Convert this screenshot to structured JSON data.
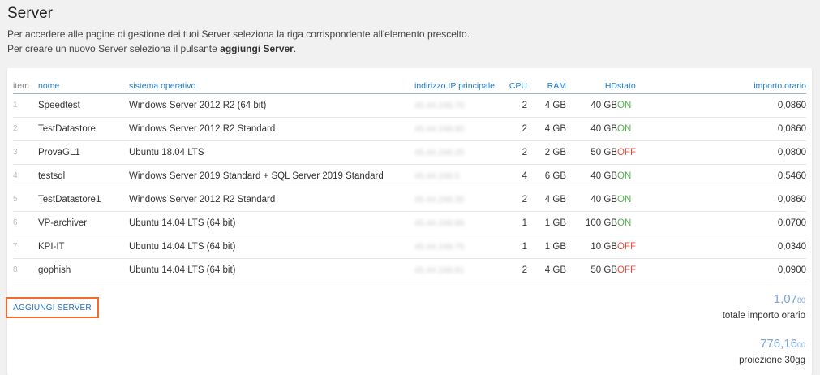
{
  "page": {
    "title": "Server",
    "desc1": "Per accedere alle pagine di gestione dei tuoi Server seleziona la riga corrispondente all'elemento prescelto.",
    "desc2_prefix": "Per creare un nuovo Server seleziona il pulsante ",
    "desc2_bold": "aggiungi Server",
    "desc2_suffix": "."
  },
  "table": {
    "headers": [
      "item",
      "nome",
      "sistema operativo",
      "indirizzo IP principale",
      "CPU",
      "RAM",
      "HD",
      "stato",
      "importo orario"
    ],
    "rows": [
      {
        "item": "1",
        "nome": "Speedtest",
        "os": "Windows Server 2012 R2 (64 bit)",
        "ip": "45.44.248.70",
        "cpu": "2",
        "ram": "4 GB",
        "hd": "40 GB",
        "stato": "ON",
        "importo": "0,0860"
      },
      {
        "item": "2",
        "nome": "TestDatastore",
        "os": "Windows Server 2012 R2 Standard",
        "ip": "45.44.248.80",
        "cpu": "2",
        "ram": "4 GB",
        "hd": "40 GB",
        "stato": "ON",
        "importo": "0,0860"
      },
      {
        "item": "3",
        "nome": "ProvaGL1",
        "os": "Ubuntu 18.04 LTS",
        "ip": "45.44.248.25",
        "cpu": "2",
        "ram": "2 GB",
        "hd": "50 GB",
        "stato": "OFF",
        "importo": "0,0800"
      },
      {
        "item": "4",
        "nome": "testsql",
        "os": "Windows Server 2019 Standard + SQL Server 2019 Standard",
        "ip": "45.44.248.5",
        "cpu": "4",
        "ram": "6 GB",
        "hd": "40 GB",
        "stato": "ON",
        "importo": "0,5460"
      },
      {
        "item": "5",
        "nome": "TestDatastore1",
        "os": "Windows Server 2012 R2 Standard",
        "ip": "45.44.248.35",
        "cpu": "2",
        "ram": "4 GB",
        "hd": "40 GB",
        "stato": "ON",
        "importo": "0,0860"
      },
      {
        "item": "6",
        "nome": "VP-archiver",
        "os": "Ubuntu 14.04 LTS (64 bit)",
        "ip": "45.44.248.88",
        "cpu": "1",
        "ram": "1 GB",
        "hd": "100 GB",
        "stato": "ON",
        "importo": "0,0700"
      },
      {
        "item": "7",
        "nome": "KPI-IT",
        "os": "Ubuntu 14.04 LTS (64 bit)",
        "ip": "45.44.248.75",
        "cpu": "1",
        "ram": "1 GB",
        "hd": "10 GB",
        "stato": "OFF",
        "importo": "0,0340"
      },
      {
        "item": "8",
        "nome": "gophish",
        "os": "Ubuntu 14.04 LTS (64 bit)",
        "ip": "45.44.248.81",
        "cpu": "2",
        "ram": "4 GB",
        "hd": "50 GB",
        "stato": "OFF",
        "importo": "0,0900"
      }
    ]
  },
  "actions": {
    "add_server": "AGGIUNGI SERVER"
  },
  "totals": {
    "hourly_main": "1,07",
    "hourly_small": "80",
    "hourly_label": "totale importo orario",
    "projection_main": "776,16",
    "projection_small": "00",
    "projection_label": "proiezione 30gg"
  },
  "colors": {
    "on": "#53b44a",
    "off": "#f04b3e",
    "accent": "#1e7ac8",
    "highlight": "#f26a2e"
  }
}
